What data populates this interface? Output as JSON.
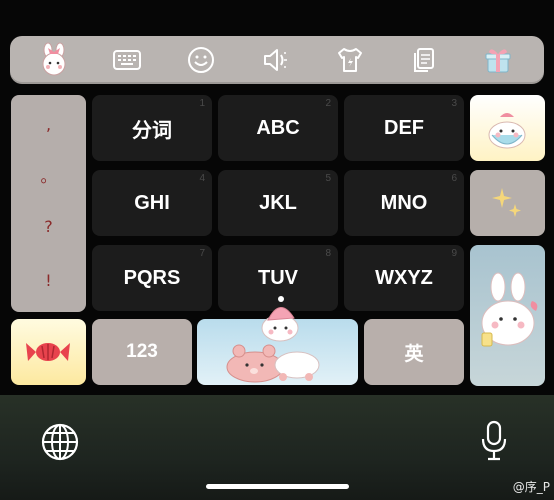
{
  "toolbar": {
    "icons": [
      "bunny-avatar-icon",
      "keyboard-icon",
      "emoji-icon",
      "speaker-icon",
      "theme-shirt-icon",
      "clipboard-icon",
      "gift-icon"
    ]
  },
  "punctuation": [
    ",",
    "。",
    "?",
    "!"
  ],
  "keys": [
    {
      "label": "分词",
      "num": "1"
    },
    {
      "label": "ABC",
      "num": "2"
    },
    {
      "label": "DEF",
      "num": "3"
    },
    {
      "label": "GHI",
      "num": "4"
    },
    {
      "label": "JKL",
      "num": "5"
    },
    {
      "label": "MNO",
      "num": "6"
    },
    {
      "label": "PQRS",
      "num": "7"
    },
    {
      "label": "TUV",
      "num": "8"
    },
    {
      "label": "WXYZ",
      "num": "9"
    }
  ],
  "bottom_row": {
    "numbers_label": "123",
    "lang_label": "英"
  },
  "watermark": "@序_P",
  "colors": {
    "toolbar": "#b9b4b1",
    "dark_key": "#1c1c1c",
    "light_key": "#b8afab",
    "punct_text": "#8a2a2a"
  }
}
